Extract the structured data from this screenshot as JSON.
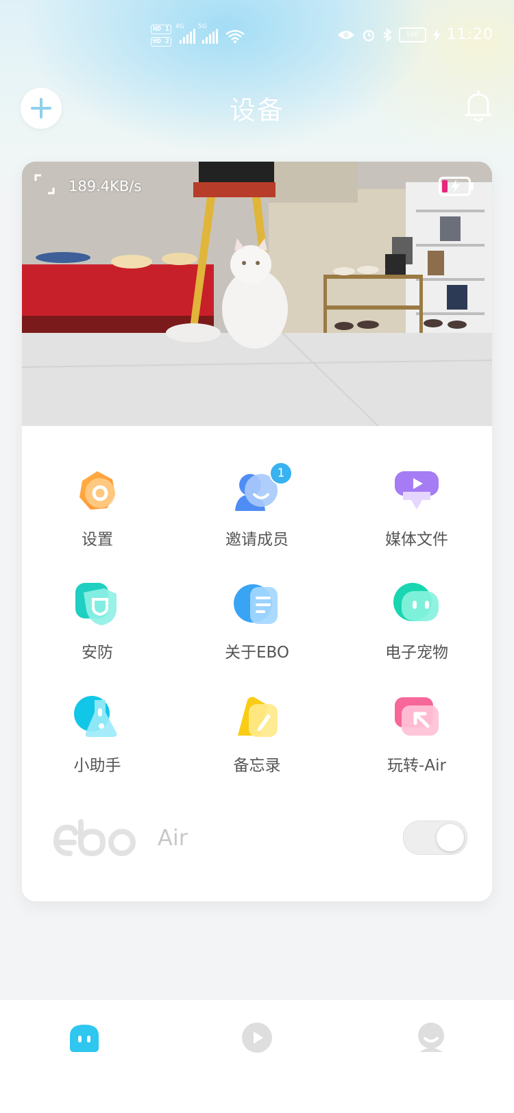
{
  "status_bar": {
    "sim1": "HD 1",
    "sim2": "HD 2",
    "net1": "4G",
    "net2": "5G",
    "battery": "100",
    "time": "11:20"
  },
  "header": {
    "title": "设备"
  },
  "camera": {
    "speed": "189.4KB/s"
  },
  "menu": [
    {
      "label": "设置",
      "icon": "settings-gear-icon"
    },
    {
      "label": "邀请成员",
      "icon": "invite-members-icon",
      "badge": "1"
    },
    {
      "label": "媒体文件",
      "icon": "media-files-icon"
    },
    {
      "label": "安防",
      "icon": "security-shield-icon"
    },
    {
      "label": "关于EBO",
      "icon": "about-document-icon"
    },
    {
      "label": "电子宠物",
      "icon": "e-pet-icon"
    },
    {
      "label": "小助手",
      "icon": "assistant-flask-icon"
    },
    {
      "label": "备忘录",
      "icon": "memo-pencil-icon"
    },
    {
      "label": "玩转-Air",
      "icon": "play-air-icon"
    }
  ],
  "device": {
    "brand": "ebo",
    "model": "Air",
    "power_on": true
  },
  "colors": {
    "accent": "#38b2f1",
    "nav_active": "#2fc6f0",
    "nav_inactive": "#dedede"
  }
}
